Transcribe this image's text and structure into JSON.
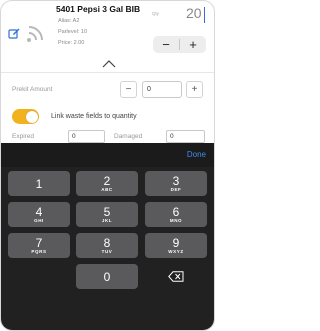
{
  "item": {
    "title": "5401 Pepsi 3 Gal BIB",
    "alias": "Alias: A2",
    "parlevel": "Parlevel: 10",
    "price": "Price: 2.00",
    "qty_label": "Qty",
    "qty_value": "20",
    "minus_label": "−",
    "plus_label": "+"
  },
  "prekit": {
    "label": "Prekit Amount",
    "minus_label": "−",
    "value": "0",
    "plus_label": "+"
  },
  "waste": {
    "toggle_label": "Link waste fields to quantity",
    "toggle_on": true,
    "expired_label": "Expired",
    "expired_value": "0",
    "damaged_label": "Damaged",
    "damaged_value": "0"
  },
  "keyboard": {
    "done_label": "Done",
    "keys": [
      {
        "num": "1",
        "letters": ""
      },
      {
        "num": "2",
        "letters": "ABC"
      },
      {
        "num": "3",
        "letters": "DEF"
      },
      {
        "num": "4",
        "letters": "GHI"
      },
      {
        "num": "5",
        "letters": "JKL"
      },
      {
        "num": "6",
        "letters": "MNO"
      },
      {
        "num": "7",
        "letters": "PQRS"
      },
      {
        "num": "8",
        "letters": "TUV"
      },
      {
        "num": "9",
        "letters": "WXYZ"
      },
      {
        "num": "0",
        "letters": ""
      }
    ],
    "backspace_icon": "backspace-icon"
  },
  "colors": {
    "accent": "#f2b21d",
    "done": "#3b8df0",
    "edit_icon": "#2f6fd6",
    "keyboard_bg": "#212121",
    "key_bg": "#5a5a5c"
  }
}
